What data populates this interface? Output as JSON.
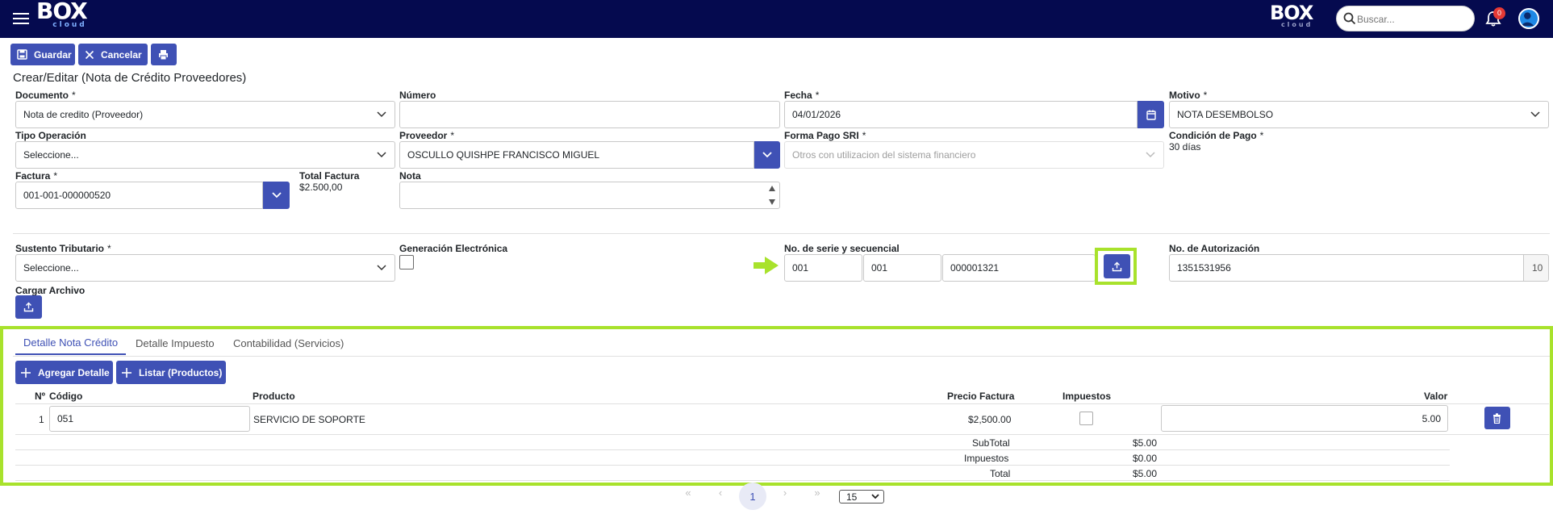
{
  "header": {
    "logo_main": "BOX",
    "logo_sub": "cloud",
    "search_placeholder": "Buscar...",
    "notification_count": "0"
  },
  "toolbar": {
    "save_label": "Guardar",
    "cancel_label": "Cancelar"
  },
  "page_title": "Crear/Editar (Nota de Crédito Proveedores)",
  "form": {
    "documento": {
      "label": "Documento",
      "value": "Nota de credito (Proveedor)"
    },
    "numero": {
      "label": "Número",
      "value": ""
    },
    "fecha": {
      "label": "Fecha",
      "value": "04/01/2026"
    },
    "motivo": {
      "label": "Motivo",
      "value": "NOTA DESEMBOLSO"
    },
    "tipo_operacion": {
      "label": "Tipo Operación",
      "value": "Seleccione..."
    },
    "proveedor": {
      "label": "Proveedor",
      "value": "OSCULLO QUISHPE FRANCISCO MIGUEL"
    },
    "forma_pago": {
      "label": "Forma Pago SRI",
      "value": "Otros con utilizacion del sistema financiero"
    },
    "condicion_pago": {
      "label": "Condición de Pago",
      "value": "30 días"
    },
    "factura": {
      "label": "Factura",
      "value": "001-001-000000520"
    },
    "total_factura": {
      "label": "Total Factura",
      "value": "$2.500,00"
    },
    "nota": {
      "label": "Nota",
      "value": ""
    },
    "sustento": {
      "label": "Sustento Tributario",
      "value": "Seleccione..."
    },
    "generacion": {
      "label": "Generación Electrónica"
    },
    "serie": {
      "label": "No. de serie y secuencial",
      "establecimiento": "001",
      "punto": "001",
      "secuencial": "000001321"
    },
    "autorizacion": {
      "label": "No. de Autorización",
      "value": "1351531956",
      "count": "10"
    },
    "cargar_archivo": {
      "label": "Cargar Archivo"
    },
    "required_mark": "*"
  },
  "tabs": [
    {
      "label": "Detalle Nota Crédito"
    },
    {
      "label": "Detalle Impuesto"
    },
    {
      "label": "Contabilidad (Servicios)"
    }
  ],
  "detail_buttons": {
    "add": "Agregar Detalle",
    "list": "Listar (Productos)"
  },
  "table": {
    "headers": [
      "Nº",
      "Código",
      "Producto",
      "Precio Factura",
      "Impuestos",
      "Valor"
    ],
    "rows": [
      {
        "n": "1",
        "codigo": "051",
        "producto": "SERVICIO DE SOPORTE",
        "precio": "$2,500.00",
        "valor": "5.00"
      }
    ],
    "totals": [
      {
        "label": "SubTotal",
        "value": "$5.00"
      },
      {
        "label": "Impuestos",
        "value": "$0.00"
      },
      {
        "label": "Total",
        "value": "$5.00"
      }
    ]
  },
  "pager": {
    "first": "«",
    "prev": "‹",
    "current": "1",
    "next": "›",
    "last": "»",
    "page_size": "15"
  }
}
